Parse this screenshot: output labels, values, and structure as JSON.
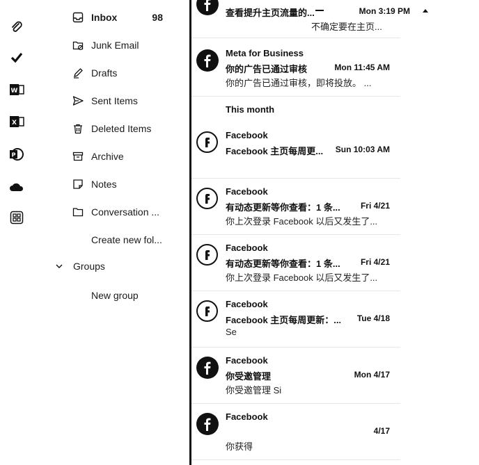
{
  "rail": {
    "icons": [
      "paperclip-icon",
      "todo-check-icon",
      "word-icon",
      "excel-icon",
      "powerpoint-icon",
      "onedrive-icon",
      "apps-grid-icon"
    ]
  },
  "folders": {
    "items": [
      {
        "label": "Inbox",
        "count": "98",
        "icon": "inbox-icon",
        "bold": true
      },
      {
        "label": "Junk Email",
        "icon": "junk-icon"
      },
      {
        "label": "Drafts",
        "icon": "drafts-icon"
      },
      {
        "label": "Sent Items",
        "icon": "sent-icon"
      },
      {
        "label": "Deleted Items",
        "icon": "trash-icon"
      },
      {
        "label": "Archive",
        "icon": "archive-icon"
      },
      {
        "label": "Notes",
        "icon": "notes-icon"
      },
      {
        "label": "Conversation ...",
        "icon": "folder-icon"
      }
    ],
    "create_new": "Create new fol...",
    "groups_label": "Groups",
    "new_group": "New group"
  },
  "mail_list": {
    "top_partial": {
      "subject": "查看提升主页流量的...",
      "time": "Mon 3:19 PM",
      "preview": "不确定要在主页..."
    },
    "section_this_month": "This month",
    "messages": [
      {
        "sender": "Meta for Business",
        "subject": "你的广告已通过审核",
        "time": "Mon 11:45 AM",
        "preview": "你的广告已通过审核，即将投放。 ...",
        "avatar": "meta-f-icon"
      },
      {
        "sender": "Facebook",
        "subject": "Facebook 主页每周更...",
        "time": "Sun 10:03 AM",
        "preview": "",
        "avatar": "facebook-f-icon"
      },
      {
        "sender": "Facebook",
        "subject": "有动态更新等你查看：1 条...",
        "time": "Fri 4/21",
        "preview": "你上次登录 Facebook 以后又发生了...",
        "avatar": "facebook-f-icon"
      },
      {
        "sender": "Facebook",
        "subject": "有动态更新等你查看：1 条...",
        "time": "Fri 4/21",
        "preview": "你上次登录 Facebook 以后又发生了...",
        "avatar": "facebook-f-icon"
      },
      {
        "sender": "Facebook",
        "subject": "Facebook 主页每周更新：...",
        "time": "Tue 4/18",
        "preview": "Se",
        "avatar": "facebook-f-icon"
      },
      {
        "sender": "Facebook",
        "subject": "你受邀管理",
        "time": "Mon 4/17",
        "preview": "你受邀管理 Si",
        "avatar": "meta-f-icon"
      },
      {
        "sender": "Facebook",
        "subject": "",
        "time": "4/17",
        "preview": "你获得",
        "avatar": "meta-f-icon"
      }
    ]
  }
}
